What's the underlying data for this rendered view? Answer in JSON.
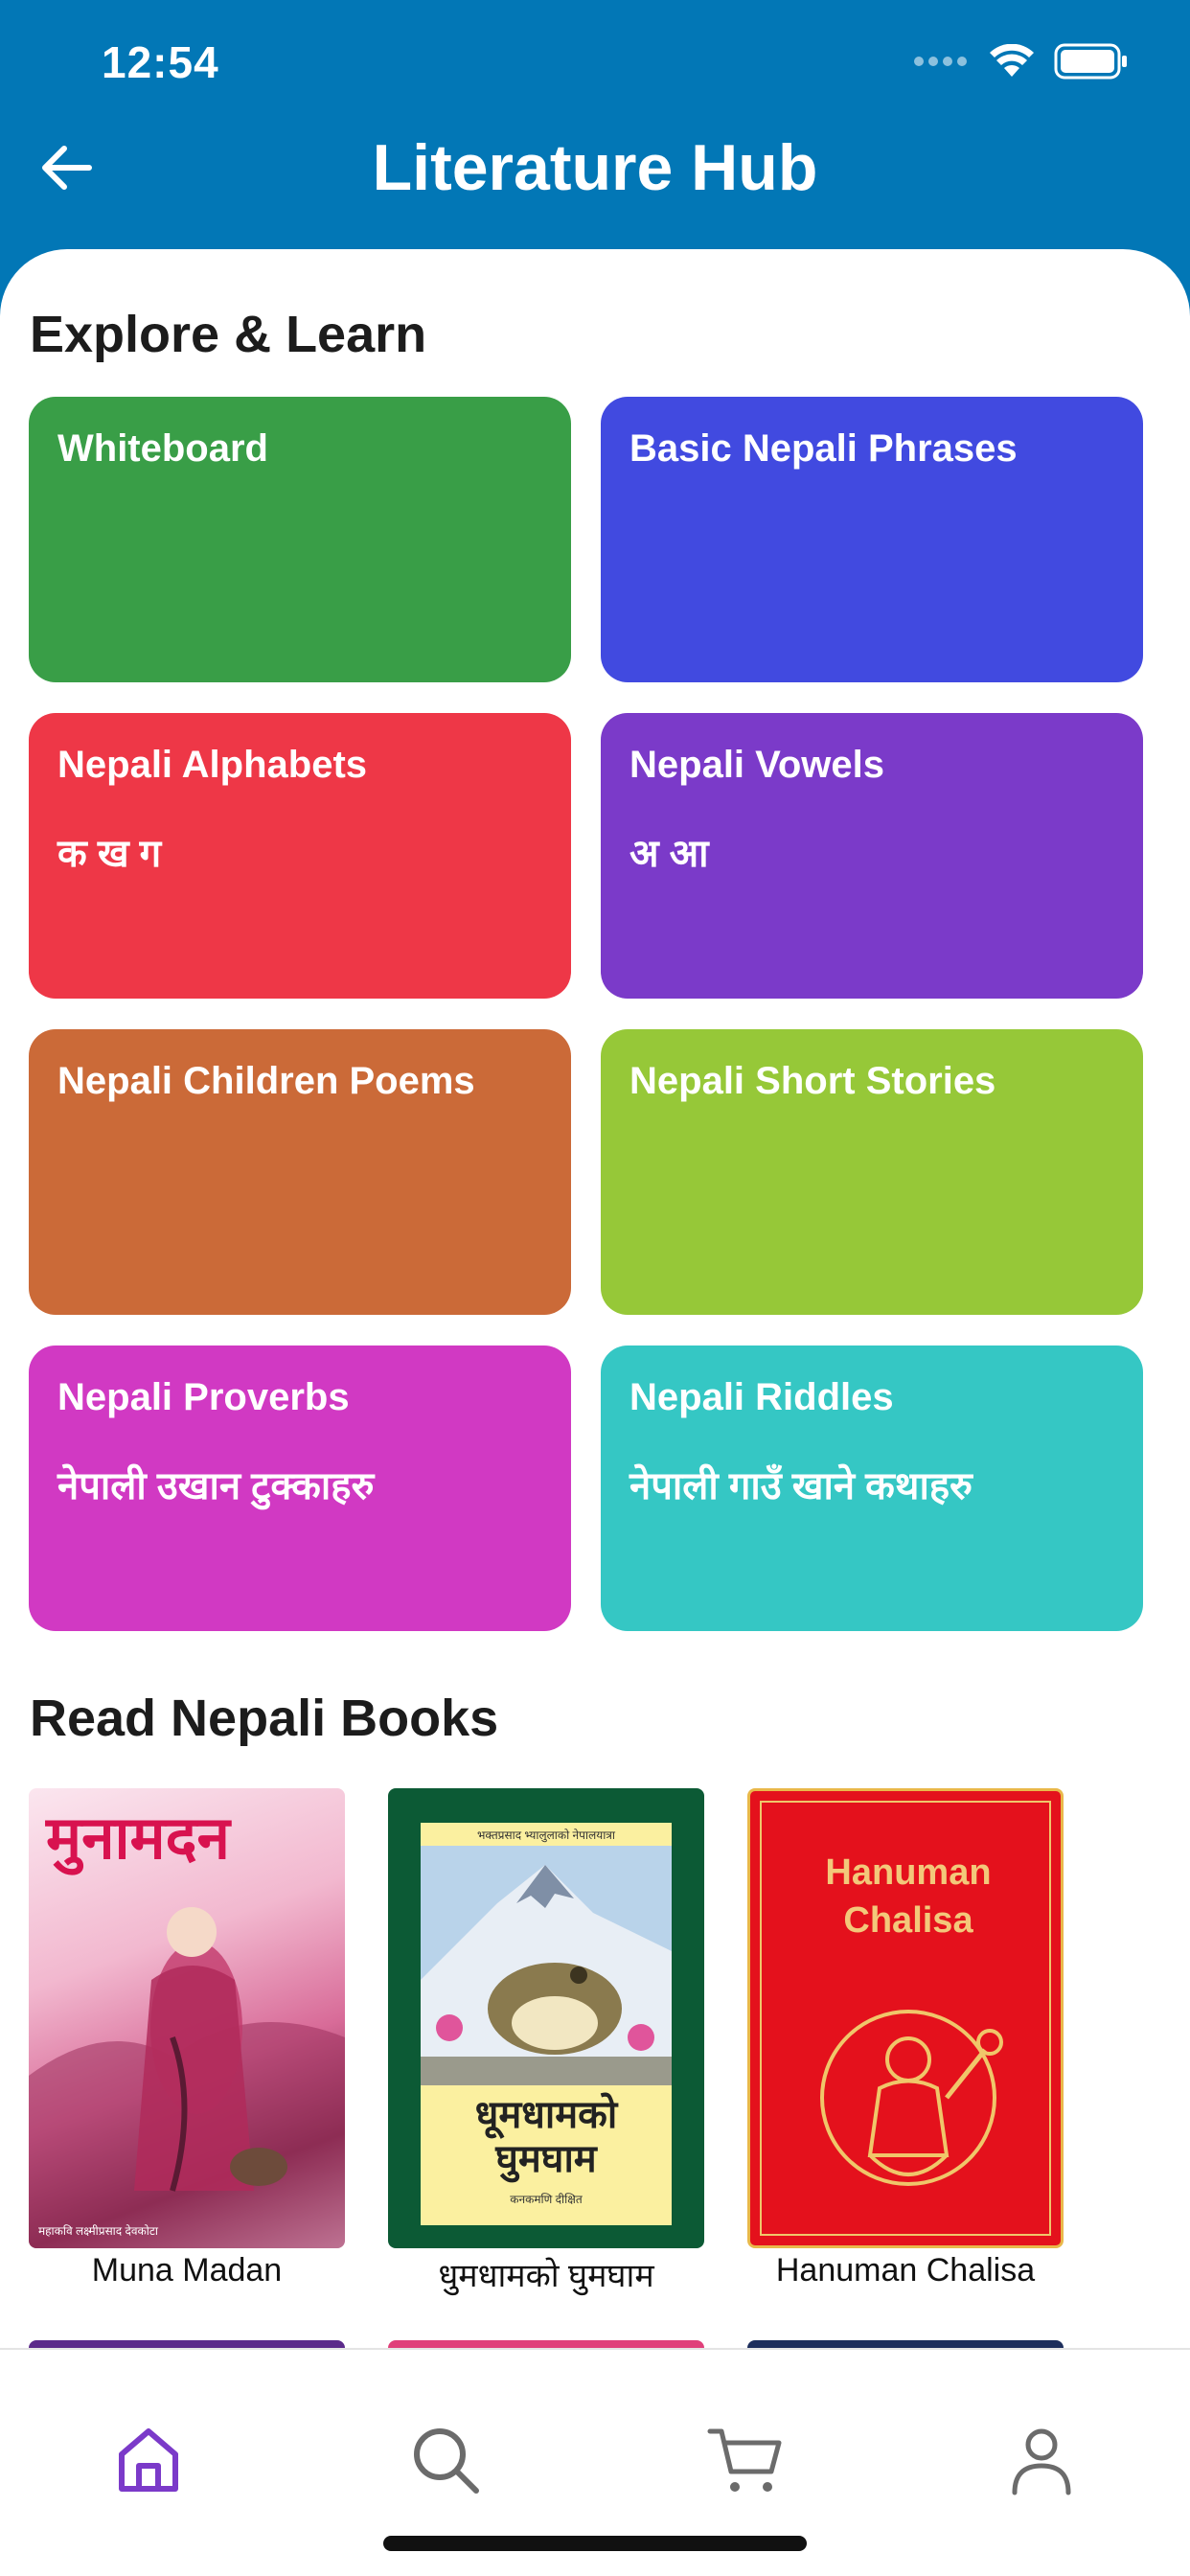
{
  "status_bar": {
    "time": "12:54"
  },
  "header": {
    "title": "Literature Hub"
  },
  "explore": {
    "heading": "Explore & Learn",
    "tiles": [
      {
        "title": "Whiteboard",
        "subtitle": "",
        "color": "#399e47"
      },
      {
        "title": "Basic Nepali Phrases",
        "subtitle": "",
        "color": "#414ae0"
      },
      {
        "title": "Nepali Alphabets",
        "subtitle": "क ख ग",
        "color": "#ee3747"
      },
      {
        "title": "Nepali Vowels",
        "subtitle": "अ आ",
        "color": "#7b3ac9"
      },
      {
        "title": "Nepali Children Poems",
        "subtitle": "",
        "color": "#cb6a38"
      },
      {
        "title": "Nepali Short Stories",
        "subtitle": "",
        "color": "#96c838"
      },
      {
        "title": "Nepali Proverbs",
        "subtitle": "नेपाली उखान टुक्काहरु",
        "color": "#d139c3"
      },
      {
        "title": "Nepali Riddles",
        "subtitle": "नेपाली गाउँ खाने कथाहरु",
        "color": "#35c7c4"
      }
    ]
  },
  "books": {
    "heading": "Read Nepali Books",
    "items": [
      {
        "title": "Muna Madan",
        "cover_text": "मुनामदन",
        "cover_footer": "महाकवि लक्ष्मीप्रसाद देवकोटा"
      },
      {
        "title": "धुमधामको घुमघाम",
        "cover_text": "धूमधामको घुमघाम",
        "cover_top": "भक्तप्रसाद भ्यालुलाको नेपालयात्रा",
        "cover_footer": "कनकमणि दीक्षित"
      },
      {
        "title": "Hanuman Chalisa",
        "cover_text": "Hanuman Chalisa"
      }
    ]
  },
  "tabbar": {
    "items": [
      "home-icon",
      "search-icon",
      "cart-icon",
      "profile-icon"
    ],
    "active_color": "#7b3ac9",
    "inactive_color": "#6b6b6b"
  }
}
